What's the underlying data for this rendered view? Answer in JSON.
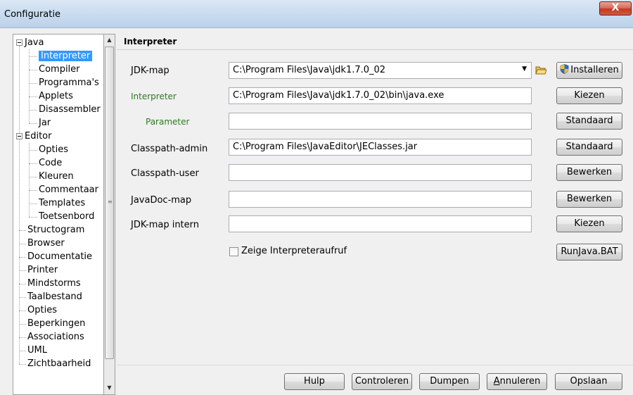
{
  "window": {
    "title": "Configuratie",
    "close_label": "X"
  },
  "tree": {
    "items": [
      {
        "label": "Java",
        "expander": true
      },
      {
        "label": "Interpreter",
        "selected": true
      },
      {
        "label": "Compiler"
      },
      {
        "label": "Programma's"
      },
      {
        "label": "Applets"
      },
      {
        "label": "Disassembler"
      },
      {
        "label": "Jar"
      },
      {
        "label": "Editor",
        "expander": true
      },
      {
        "label": "Opties"
      },
      {
        "label": "Code"
      },
      {
        "label": "Kleuren"
      },
      {
        "label": "Commentaar"
      },
      {
        "label": "Templates"
      },
      {
        "label": "Toetsenbord"
      },
      {
        "label": "Structogram"
      },
      {
        "label": "Browser"
      },
      {
        "label": "Documentatie"
      },
      {
        "label": "Printer"
      },
      {
        "label": "Mindstorms"
      },
      {
        "label": "Taalbestand"
      },
      {
        "label": "Opties"
      },
      {
        "label": "Beperkingen"
      },
      {
        "label": "Associations"
      },
      {
        "label": "UML"
      },
      {
        "label": "Zichtbaarheid"
      }
    ],
    "scroll_up": "▲",
    "scroll_down": "▼",
    "scroll_grip": "≡"
  },
  "panel": {
    "header": "Interpreter"
  },
  "form": {
    "jdk_map": {
      "label": "JDK-map",
      "value": "C:\\Program Files\\Java\\jdk1.7.0_02",
      "arrow": "▼",
      "button": "Installeren"
    },
    "interpreter": {
      "label": "Interpreter",
      "value": "C:\\Program Files\\Java\\jdk1.7.0_02\\bin\\java.exe",
      "button": "Kiezen"
    },
    "parameter": {
      "label": "Parameter",
      "value": "",
      "button": "Standaard"
    },
    "classpath_admin": {
      "label": "Classpath-admin",
      "value": "C:\\Program Files\\JavaEditor\\JEClasses.jar",
      "button": "Standaard"
    },
    "classpath_user": {
      "label": "Classpath-user",
      "value": "",
      "button": "Bewerken"
    },
    "javadoc_map": {
      "label": "JavaDoc-map",
      "value": "",
      "button": "Bewerken"
    },
    "jdk_map_intern": {
      "label": "JDK-map intern",
      "value": "",
      "button": "Kiezen"
    },
    "show_call": {
      "label": "Zeige Interpreteraufruf",
      "checked": false,
      "button": "RunJava.BAT"
    }
  },
  "footer": {
    "help": "Hulp",
    "check": "Controleren",
    "dump": "Dumpen",
    "cancel_u": "A",
    "cancel_rest": "nnuleren",
    "save": "Opslaan"
  },
  "colors": {
    "selection": "#3399ff",
    "label_green": "#2b7a1f"
  }
}
